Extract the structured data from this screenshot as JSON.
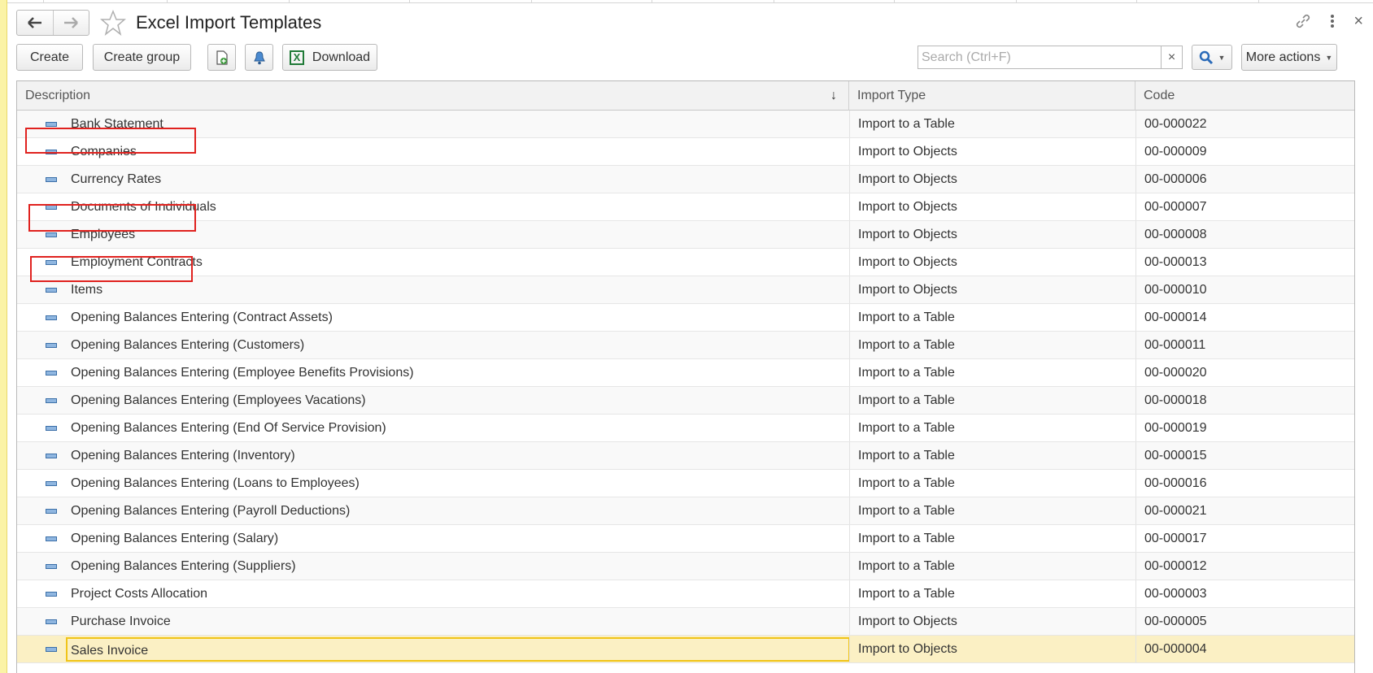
{
  "window": {
    "title": "Excel Import Templates",
    "back_icon": "arrow-left-icon",
    "forward_icon": "arrow-right-icon",
    "favorite_icon": "star-icon",
    "link_icon": "link-icon",
    "menu_icon": "more-vertical-icon",
    "close_glyph": "×"
  },
  "toolbar": {
    "create_label": "Create",
    "create_group_label": "Create group",
    "download_label": "Download",
    "search_placeholder": "Search (Ctrl+F)",
    "search_value": "",
    "clear_glyph": "×",
    "more_actions_label": "More actions",
    "excel_glyph": "X"
  },
  "table": {
    "columns": [
      "Description",
      "Import Type",
      "Code"
    ],
    "sort_glyph": "↓",
    "rows": [
      {
        "description": "Bank Statement",
        "type": "Import to a Table",
        "code": "00-000022"
      },
      {
        "description": "Companies",
        "type": "Import to Objects",
        "code": "00-000009"
      },
      {
        "description": "Currency Rates",
        "type": "Import to Objects",
        "code": "00-000006"
      },
      {
        "description": "Documents of Individuals",
        "type": "Import to Objects",
        "code": "00-000007"
      },
      {
        "description": "Employees",
        "type": "Import to Objects",
        "code": "00-000008"
      },
      {
        "description": "Employment Contracts",
        "type": "Import to Objects",
        "code": "00-000013"
      },
      {
        "description": "Items",
        "type": "Import to Objects",
        "code": "00-000010"
      },
      {
        "description": "Opening Balances Entering (Contract Assets)",
        "type": "Import to a Table",
        "code": "00-000014"
      },
      {
        "description": "Opening Balances Entering (Customers)",
        "type": "Import to a Table",
        "code": "00-000011"
      },
      {
        "description": "Opening Balances Entering (Employee Benefits Provisions)",
        "type": "Import to a Table",
        "code": "00-000020"
      },
      {
        "description": "Opening Balances Entering (Employees Vacations)",
        "type": "Import to a Table",
        "code": "00-000018"
      },
      {
        "description": "Opening Balances Entering (End Of Service Provision)",
        "type": "Import to a Table",
        "code": "00-000019"
      },
      {
        "description": "Opening Balances Entering (Inventory)",
        "type": "Import to a Table",
        "code": "00-000015"
      },
      {
        "description": "Opening Balances Entering (Loans to Employees)",
        "type": "Import to a Table",
        "code": "00-000016"
      },
      {
        "description": "Opening Balances Entering (Payroll Deductions)",
        "type": "Import to a Table",
        "code": "00-000021"
      },
      {
        "description": "Opening Balances Entering (Salary)",
        "type": "Import to a Table",
        "code": "00-000017"
      },
      {
        "description": "Opening Balances Entering (Suppliers)",
        "type": "Import to a Table",
        "code": "00-000012"
      },
      {
        "description": "Project Costs Allocation",
        "type": "Import to a Table",
        "code": "00-000003"
      },
      {
        "description": "Purchase Invoice",
        "type": "Import to Objects",
        "code": "00-000005"
      },
      {
        "description": "Sales Invoice",
        "type": "Import to Objects",
        "code": "00-000004"
      }
    ],
    "selected_row": "Sales Invoice",
    "highlighted_rows": [
      "Companies",
      "Employees",
      "Items"
    ]
  },
  "colors": {
    "highlight_box": "#e0221f",
    "selected_row": "#fbf0c4",
    "selected_border": "#f0c419",
    "excel_green": "#1f7a37"
  }
}
